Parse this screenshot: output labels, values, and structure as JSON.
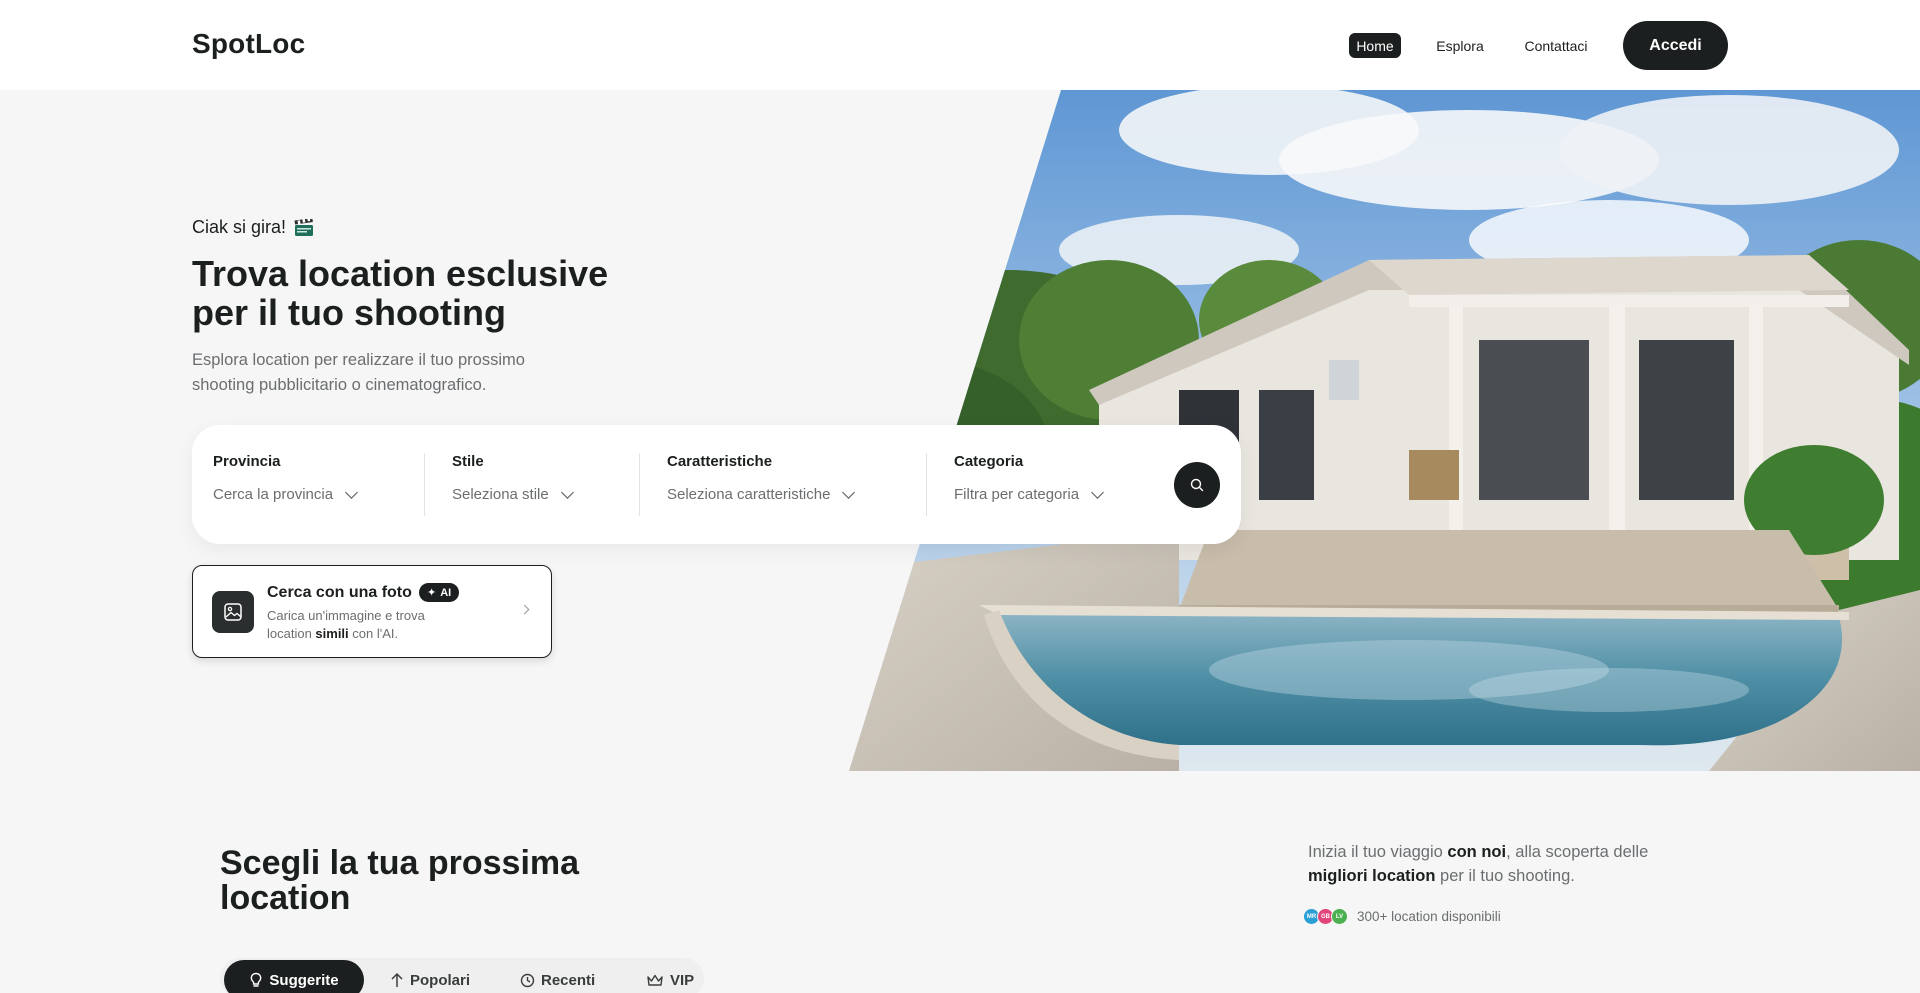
{
  "header": {
    "logo": "SpotLoc",
    "nav": {
      "home": "Home",
      "explore": "Esplora",
      "contact": "Contattaci"
    },
    "login": "Accedi"
  },
  "hero": {
    "tagline": "Ciak si gira!",
    "title": "Trova location esclusive per il tuo shooting",
    "subtitle": "Esplora location per realizzare il tuo prossimo shooting pubblicitario o cinematografico."
  },
  "search": {
    "fields": [
      {
        "label": "Provincia",
        "placeholder": "Cerca la provincia"
      },
      {
        "label": "Stile",
        "placeholder": "Seleziona stile"
      },
      {
        "label": "Caratteristiche",
        "placeholder": "Seleziona caratteristiche"
      },
      {
        "label": "Categoria",
        "placeholder": "Filtra per categoria"
      }
    ]
  },
  "photo_search": {
    "title": "Cerca con una foto",
    "badge": "AI",
    "desc_before": "Carica un'immagine e trova location ",
    "desc_bold": "simili",
    "desc_after": " con l'AI."
  },
  "section": {
    "title": "Scegli la tua prossima location",
    "intro_1": "Inizia il tuo viaggio ",
    "intro_bold_1": "con noi",
    "intro_2": ", alla scoperta delle ",
    "intro_bold_2": "migliori location",
    "intro_3": " per il tuo shooting.",
    "avatars": [
      {
        "initials": "MR",
        "color": "#2a9fd6"
      },
      {
        "initials": "GB",
        "color": "#e0457b"
      },
      {
        "initials": "LV",
        "color": "#4caf50"
      }
    ],
    "count": "300+ location disponibili"
  },
  "tabs": [
    {
      "label": "Suggerite",
      "icon": "bulb-icon",
      "active": true
    },
    {
      "label": "Popolari",
      "icon": "arrow-up-icon",
      "active": false
    },
    {
      "label": "Recenti",
      "icon": "clock-icon",
      "active": false
    },
    {
      "label": "VIP",
      "icon": "crown-icon",
      "active": false
    }
  ]
}
